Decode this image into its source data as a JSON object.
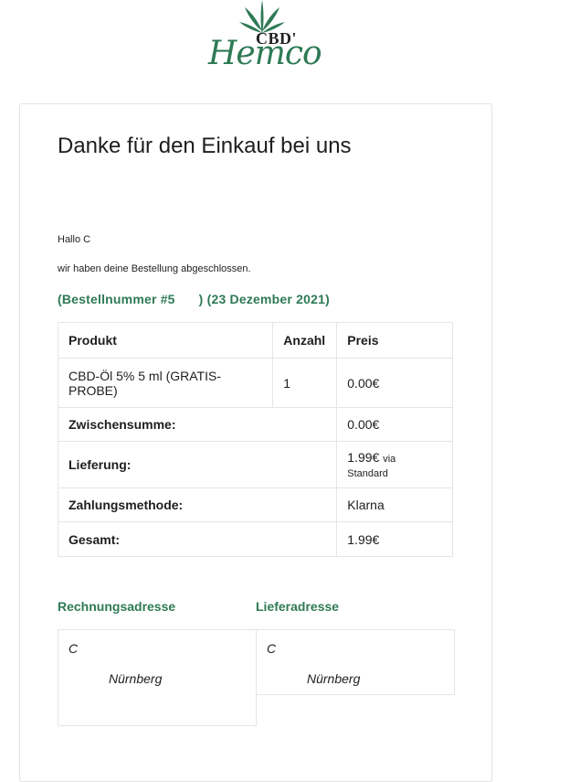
{
  "brand": {
    "logo_top": "CBD'",
    "logo_script": "Hemco",
    "accent_color": "#2e7a55",
    "icon": "cannabis-leaf-icon"
  },
  "email": {
    "heading": "Danke für den Einkauf bei uns",
    "greeting": "Hallo C",
    "notice": "wir haben deine Bestellung abgeschlossen.",
    "order_prefix": "(Bestellnummer #5",
    "order_suffix": ") (23 Dezember 2021)"
  },
  "table": {
    "headers": {
      "product": "Produkt",
      "qty": "Anzahl",
      "price": "Preis"
    },
    "item": {
      "product": "CBD-Öl 5% 5 ml (GRATIS-PROBE)",
      "qty": "1",
      "price": "0.00€"
    },
    "subtotal": {
      "label": "Zwischensumme:",
      "value": "0.00€"
    },
    "shipping": {
      "label": "Lieferung:",
      "value": "1.99€",
      "via": "via",
      "method": "Standard"
    },
    "payment": {
      "label": "Zahlungsmethode:",
      "value": "Klarna"
    },
    "total": {
      "label": "Gesamt:",
      "value": "1.99€"
    }
  },
  "addresses": {
    "billing_title": "Rechnungsadresse",
    "shipping_title": "Lieferadresse",
    "billing": {
      "name": "C",
      "city": "Nürnberg"
    },
    "shipping": {
      "name": "C",
      "city": "Nürnberg"
    }
  }
}
